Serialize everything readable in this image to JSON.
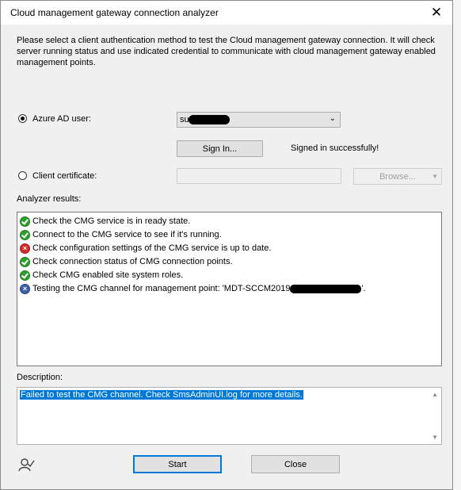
{
  "dialog": {
    "title": "Cloud management gateway connection analyzer",
    "close_glyph": "✕",
    "intro": "Please select a client authentication method to test the Cloud management gateway connection. It will check server running status and use indicated credential to communicate with cloud management gateway enabled management points."
  },
  "auth": {
    "azure_label": "Azure AD user:",
    "azure_selected": true,
    "azure_user_visible": "su",
    "signin_label": "Sign In...",
    "signin_status": "Signed in successfully!",
    "cert_label": "Client certificate:",
    "cert_selected": false,
    "browse_label": "Browse..."
  },
  "results": {
    "label": "Analyzer results:",
    "items": [
      {
        "status": "success",
        "text": "Check the CMG service is in ready state."
      },
      {
        "status": "success",
        "text": "Connect to the CMG service to see if it's running."
      },
      {
        "status": "error",
        "text": "Check configuration settings of the CMG service is up to date."
      },
      {
        "status": "success",
        "text": "Check connection status of CMG connection points."
      },
      {
        "status": "success",
        "text": "Check CMG enabled site system roles."
      },
      {
        "status": "running",
        "text_prefix": "Testing the CMG channel for management point: 'MDT-SCCM2019.",
        "text_suffix": "'."
      }
    ]
  },
  "description": {
    "label": "Description:",
    "text": "Failed to test the CMG channel. Check SmsAdminUI.log for more details."
  },
  "footer": {
    "start_label": "Start",
    "close_label": "Close"
  },
  "colors": {
    "accent": "#0078d7",
    "success": "#2e9e2e",
    "error": "#d42a2a",
    "running": "#3f5fa8"
  }
}
